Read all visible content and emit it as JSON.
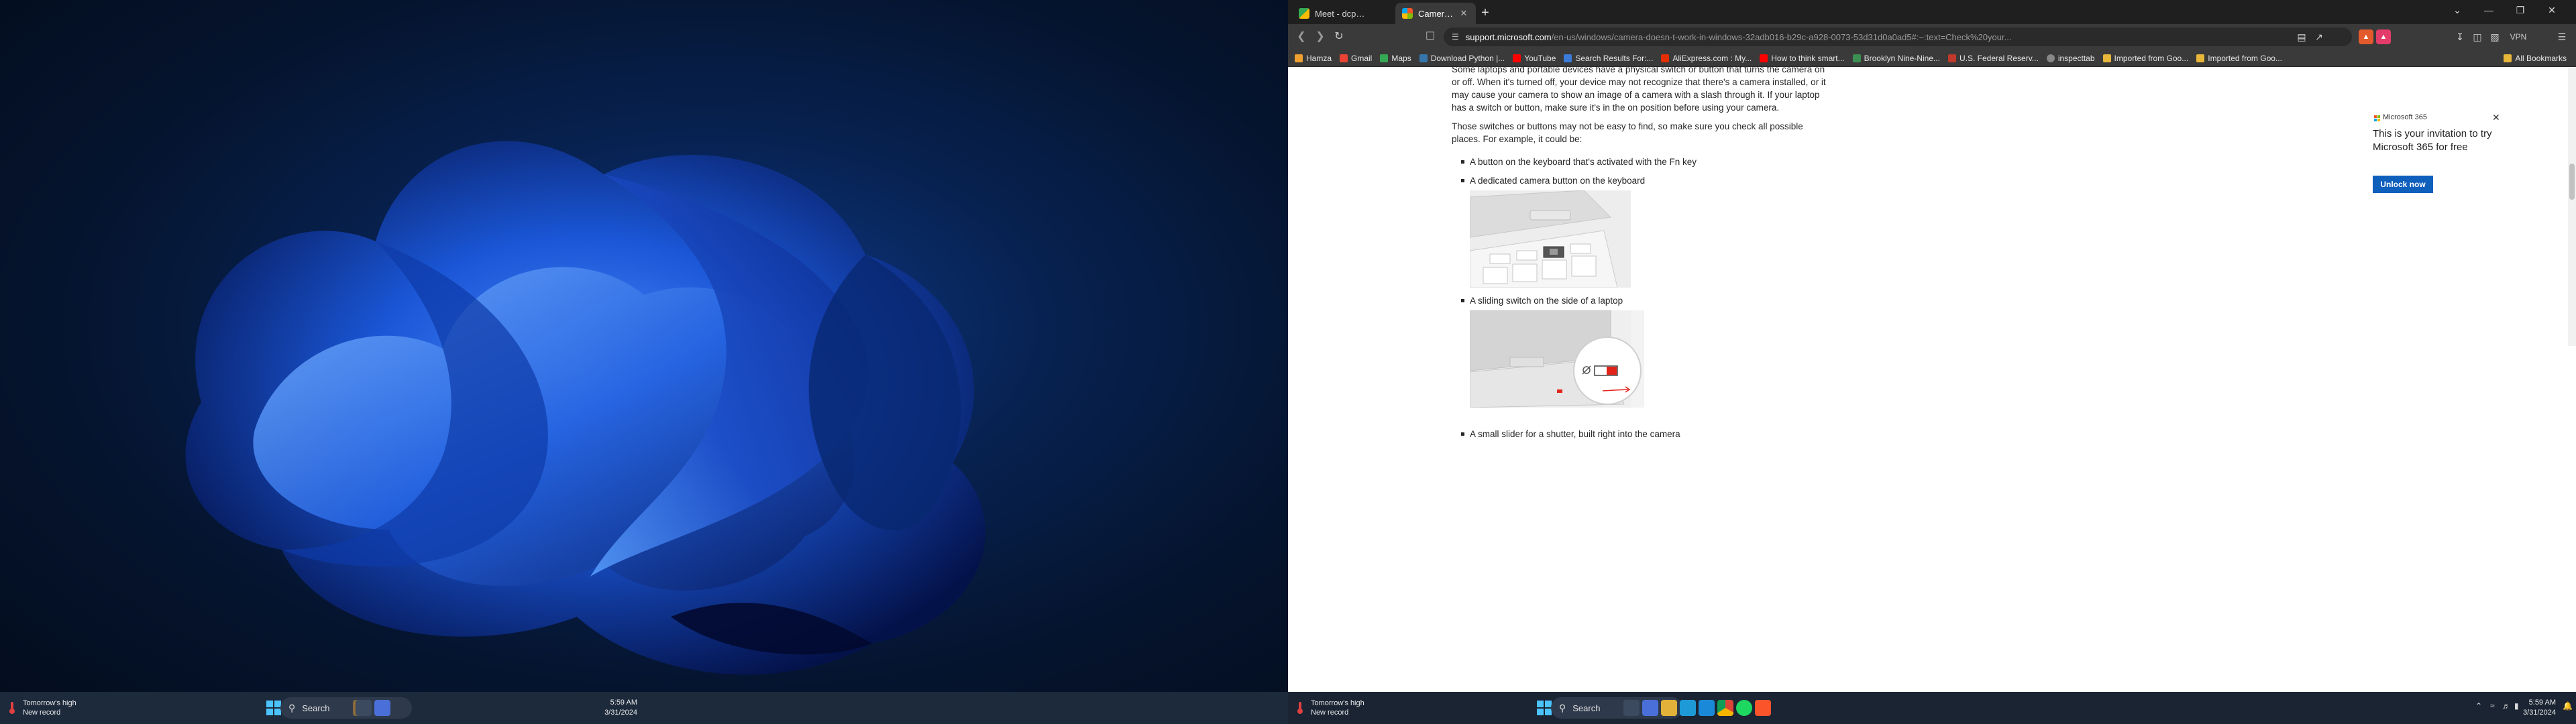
{
  "left_taskbar": {
    "weather_line1": "Tomorrow's high",
    "weather_line2": "New record",
    "search_label": "Search",
    "clock_time": "5:59 AM",
    "clock_date": "3/31/2024"
  },
  "browser": {
    "tabs": [
      {
        "title": "Meet - dcp-zykj-rat",
        "active": false
      },
      {
        "title": "Camera doesn't work in Windo...",
        "active": true
      }
    ],
    "url_domain": "support.microsoft.com",
    "url_rest": "/en-us/windows/camera-doesn-t-work-in-windows-32adb016-b29c-a928-0073-53d31d0a0ad5#:~:text=Check%20your...",
    "vpn_label": "VPN",
    "bookmarks": [
      {
        "label": "Hamza",
        "color": "#f0a030"
      },
      {
        "label": "Gmail",
        "color": "#ea4335"
      },
      {
        "label": "Maps",
        "color": "#34a853"
      },
      {
        "label": "Download Python |...",
        "color": "#3776ab"
      },
      {
        "label": "YouTube",
        "color": "#ff0000"
      },
      {
        "label": "Search Results For:...",
        "color": "#3d7bd9"
      },
      {
        "label": "AliExpress.com : My...",
        "color": "#e62e04"
      },
      {
        "label": "How to think smart...",
        "color": "#ff0000"
      },
      {
        "label": "Brooklyn Nine-Nine...",
        "color": "#3c8f52"
      },
      {
        "label": "U.S. Federal Reserv...",
        "color": "#c0392b"
      },
      {
        "label": "inspecttab",
        "color": "#888888"
      },
      {
        "label": "Imported from Goo...",
        "color": "#e8b73a"
      },
      {
        "label": "Imported from Goo...",
        "color": "#e8b73a"
      }
    ],
    "all_bookmarks": "All Bookmarks"
  },
  "article": {
    "para1": "Some laptops and portable devices have a physical switch or button that turns the camera on or off. When it's turned off, your device may not recognize that there's a camera installed, or it may cause your camera to show an image of a camera with a slash through it. If your laptop has a switch or button, make sure it's in the on position before using your camera.",
    "para2": "Those switches or buttons may not be easy to find, so make sure you check all possible places. For example, it could be:",
    "bullets": [
      "A button on the keyboard that's activated with the Fn key",
      "A dedicated camera button on the keyboard",
      "A sliding switch on the side of a laptop",
      "A small slider for a shutter, built right into the camera"
    ]
  },
  "promo": {
    "brand": "Microsoft 365",
    "headline": "This is your invitation to try Microsoft 365 for free",
    "cta": "Unlock now"
  },
  "right_taskbar": {
    "weather_line1": "Tomorrow's high",
    "weather_line2": "New record",
    "search_label": "Search",
    "clock_time": "5:59 AM",
    "clock_date": "3/31/2024"
  },
  "colors": {
    "wallpaper_blue": "#1a56d6",
    "accent_blue": "#0f5fbd",
    "slider_red": "#e2231a"
  }
}
